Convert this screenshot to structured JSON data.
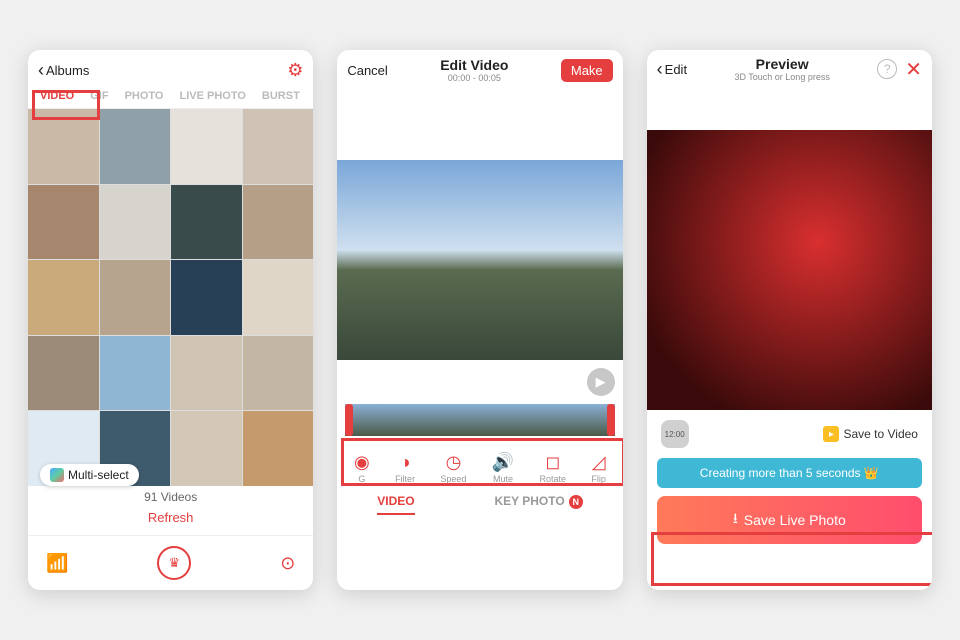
{
  "screen1": {
    "back_label": "Albums",
    "tabs": [
      "VIDEO",
      "GIF",
      "PHOTO",
      "LIVE PHOTO",
      "BURST"
    ],
    "active_tab": 0,
    "multi_select": "Multi-select",
    "count": "91 Videos",
    "refresh": "Refresh"
  },
  "screen2": {
    "cancel": "Cancel",
    "title": "Edit Video",
    "timecode": "00:00 - 00:05",
    "make": "Make",
    "tools": [
      {
        "label": "G",
        "icon": "◉"
      },
      {
        "label": "Filter",
        "icon": "◑"
      },
      {
        "label": "Speed",
        "icon": "◷"
      },
      {
        "label": "Mute",
        "icon": "🔊"
      },
      {
        "label": "Rotate",
        "icon": "◻"
      },
      {
        "label": "Flip",
        "icon": "◿"
      }
    ],
    "bottom_tabs": {
      "video": "VIDEO",
      "key": "KEY PHOTO",
      "badge": "N"
    }
  },
  "screen3": {
    "back": "Edit",
    "title": "Preview",
    "subtitle": "3D Touch or Long press",
    "duration_badge": "12:00",
    "save_to_video": "Save to Video",
    "info": "Creating more than 5 seconds 👑",
    "save_live": "Save Live Photo"
  }
}
